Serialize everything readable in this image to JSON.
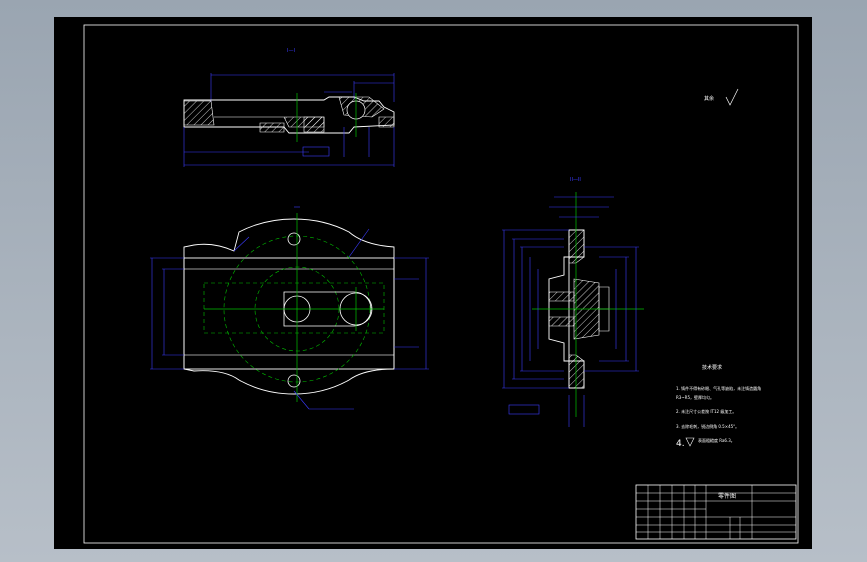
{
  "drawing": {
    "view_top_label": "I—I",
    "view_right_label": "II—II",
    "surface_finish_note": "其余",
    "notes": {
      "title": "技术要求",
      "line1": "1. 铸件不得有砂眼、气孔等缺陷，未注铸造圆角",
      "line1b": "R3~R5，壁厚均匀。",
      "line2": "2. 未注尺寸公差按 IT12 级加工。",
      "line3": "3. 去除毛刺，锐边倒角 0.5×45°。",
      "line4": "4.",
      "line4b": "表面粗糙度 Ra6.3。"
    },
    "title_block": {
      "name": "零件图"
    }
  },
  "colors": {
    "background": "#000000",
    "outline": "#ffffff",
    "dimension": "#3b3bff",
    "centerline": "#00c000",
    "hatch": "#ffffff",
    "leader": "#3b3bff"
  }
}
